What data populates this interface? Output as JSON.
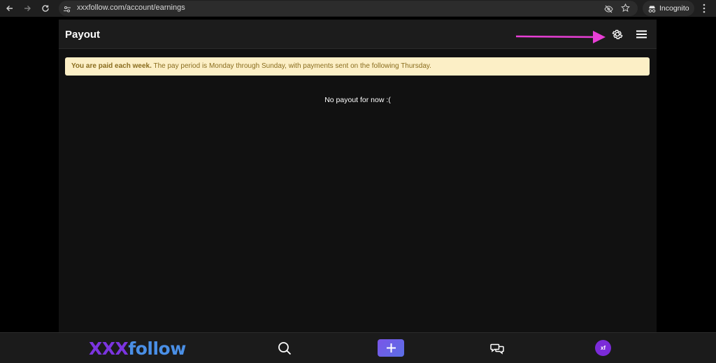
{
  "browser": {
    "url": "xxxfollow.com/account/earnings",
    "incognito_label": "Incognito"
  },
  "header": {
    "title": "Payout"
  },
  "notice": {
    "bold": "You are paid each week.",
    "text": " The pay period is Monday through Sunday, with payments sent on the following Thursday."
  },
  "main": {
    "empty_message": "No payout for now :("
  },
  "bottom_nav": {
    "logo_part1": "XXX",
    "logo_part2": "follow",
    "avatar_initials": "xf"
  },
  "colors": {
    "annotation_arrow": "#e83fd6",
    "brand_purple": "#7b34e0",
    "brand_blue": "#4a8fe6",
    "notice_bg": "#fcefc6"
  }
}
